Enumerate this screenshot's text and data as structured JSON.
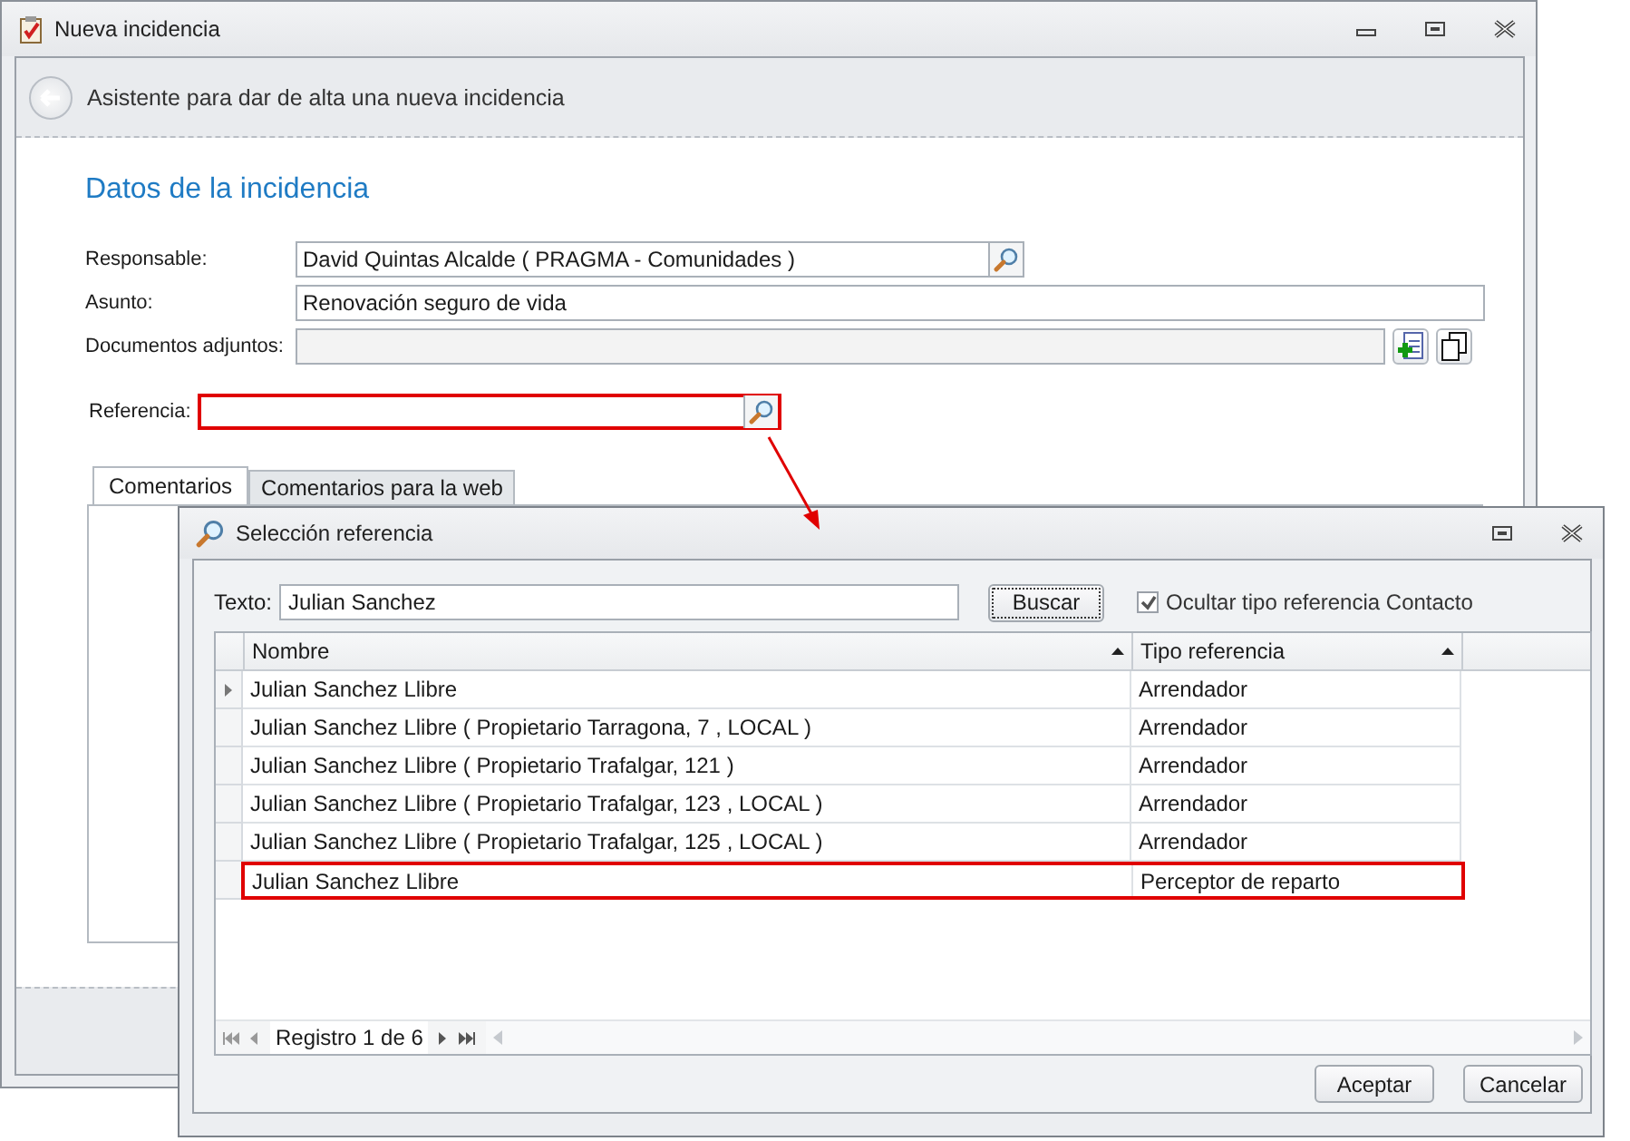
{
  "main_window": {
    "title": "Nueva incidencia",
    "header": "Asistente para dar de alta una nueva incidencia",
    "section_title": "Datos de la incidencia",
    "fields": [
      {
        "kind": "lookup",
        "label": "Responsable:",
        "value": "David Quintas Alcalde ( PRAGMA - Comunidades )"
      },
      {
        "kind": "text",
        "label": "Asunto:",
        "value": "Renovación seguro de vida"
      },
      {
        "kind": "attachments",
        "label": "Documentos adjuntos:",
        "disabled": true
      }
    ],
    "reference": {
      "label": "Referencia:",
      "highlighted": true
    },
    "tabs": [
      {
        "label": "Comentarios",
        "selected": true
      },
      {
        "label": "Comentarios para la web",
        "selected": false
      }
    ]
  },
  "dialog": {
    "title": "Selección referencia",
    "search_label": "Texto:",
    "search_value": "Julian Sanchez",
    "search_button": "Buscar",
    "hide_contact": {
      "label": "Ocultar tipo referencia Contacto",
      "checked": true
    },
    "columns": [
      {
        "label": "Nombre",
        "sorted": true
      },
      {
        "label": "Tipo referencia",
        "sorted": true
      }
    ],
    "rows": [
      {
        "cells": [
          "Julian Sanchez Llibre",
          "Arrendador"
        ],
        "selected": true,
        "highlighted": false
      },
      {
        "cells": [
          "Julian Sanchez Llibre ( Propietario Tarragona, 7 , LOCAL )",
          "Arrendador"
        ],
        "selected": false,
        "highlighted": false
      },
      {
        "cells": [
          "Julian Sanchez Llibre ( Propietario Trafalgar, 121 )",
          "Arrendador"
        ],
        "selected": false,
        "highlighted": false
      },
      {
        "cells": [
          "Julian Sanchez Llibre ( Propietario Trafalgar, 123 , LOCAL )",
          "Arrendador"
        ],
        "selected": false,
        "highlighted": false
      },
      {
        "cells": [
          "Julian Sanchez Llibre ( Propietario Trafalgar, 125 , LOCAL )",
          "Arrendador"
        ],
        "selected": false,
        "highlighted": false
      },
      {
        "cells": [
          "Julian Sanchez Llibre",
          "Perceptor de reparto"
        ],
        "selected": false,
        "highlighted": true
      }
    ],
    "navigator": "Registro 1 de 6",
    "buttons": [
      "Aceptar",
      "Cancelar"
    ]
  }
}
